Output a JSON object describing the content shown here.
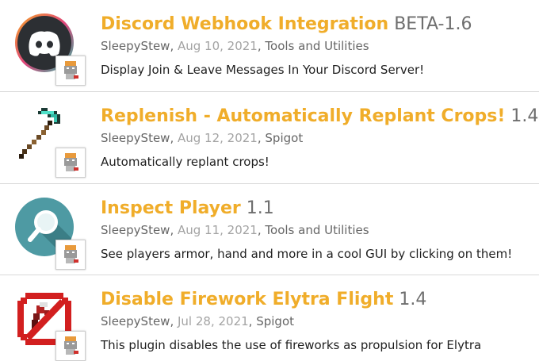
{
  "resources": [
    {
      "title": "Discord Webhook Integration",
      "version": "BETA-1.6",
      "author": "SleepyStew",
      "date": "Aug 10, 2021",
      "category": "Tools and Utilities",
      "description": "Display Join & Leave Messages In Your Discord Server!",
      "icon": "discord-logo-icon"
    },
    {
      "title": "Replenish - Automatically Replant Crops!",
      "version": "1.4",
      "author": "SleepyStew",
      "date": "Aug 12, 2021",
      "category": "Spigot",
      "description": "Automatically replant crops!",
      "icon": "diamond-hoe-icon"
    },
    {
      "title": "Inspect Player",
      "version": "1.1",
      "author": "SleepyStew",
      "date": "Aug 11, 2021",
      "category": "Tools and Utilities",
      "description": "See players armor, hand and more in a cool GUI by clicking on them!",
      "icon": "magnifier-icon"
    },
    {
      "title": "Disable Firework Elytra Flight",
      "version": "1.4",
      "author": "SleepyStew",
      "date": "Jul 28, 2021",
      "category": "Spigot",
      "description": "This plugin disables the use of fireworks as propulsion for Elytra",
      "icon": "no-firework-icon"
    }
  ],
  "separator": ", ",
  "colors": {
    "title": "#f0ad2a",
    "version": "#6e6e6e",
    "meta": "#666666",
    "date": "#a3a3a3",
    "description": "#1f1f1f",
    "divider": "#d9d9d9"
  }
}
